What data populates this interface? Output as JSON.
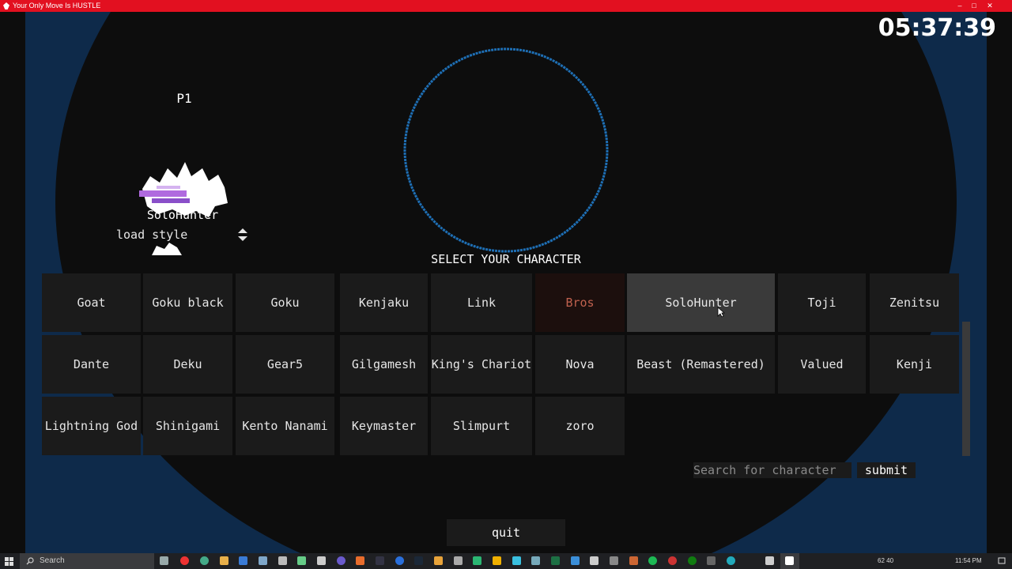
{
  "window": {
    "title": "Your Only Move Is HUSTLE"
  },
  "timer": "05:37:39",
  "player": {
    "label": "P1",
    "character": "SoloHunter",
    "style_select": "load style"
  },
  "heading": "SELECT YOUR CHARACTER",
  "characters": [
    [
      "Goat",
      "Goku black",
      "Goku",
      "Kenjaku",
      "Link",
      "Bros",
      "SoloHunter",
      "Toji",
      "Zenitsu"
    ],
    [
      "Dante",
      "Deku",
      "Gear5",
      "Gilgamesh",
      "King's Chariot",
      "Nova",
      "Beast (Remastered)",
      "Valued",
      "Kenji"
    ],
    [
      "Lightning God",
      "Shinigami",
      "Kento Nanami",
      "Keymaster",
      "Slimpurt",
      "zoro"
    ]
  ],
  "search": {
    "placeholder": "Search for character",
    "submit_label": "submit"
  },
  "quit_label": "quit",
  "taskbar": {
    "search_label": "Search",
    "tray_text": "62  40",
    "clock": "11:54 PM"
  },
  "colors": {
    "title_bar": "#e21020",
    "background_blue": "#0e2a4a",
    "circle_stroke": "#1e6fb5",
    "cell_bg": "#1b1b1b",
    "cell_hover": "#3a3a3a",
    "unavailable_text": "#c0614e"
  }
}
